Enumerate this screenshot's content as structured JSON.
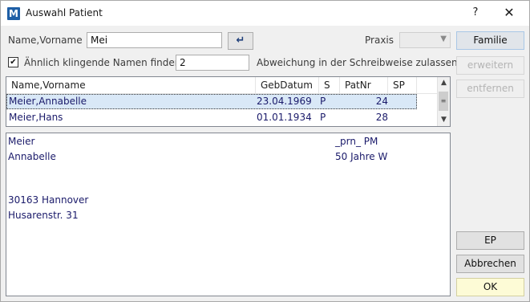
{
  "window": {
    "title": "Auswahl Patient",
    "app_icon_letter": "M",
    "help_label": "?",
    "close_label": "✕"
  },
  "search": {
    "name_label": "Name,Vorname",
    "name_value": "Mei",
    "enter_icon": "↵",
    "praxis_label": "Praxis",
    "praxis_value": "",
    "similar_label": "Ähnlich klingende Namen finden",
    "similar_checked": true,
    "deviation_value": "2",
    "deviation_label": "Abweichung in der Schreibweise zulassen"
  },
  "table": {
    "columns": [
      "Name,Vorname",
      "GebDatum",
      "S",
      "PatNr",
      "SP"
    ],
    "rows": [
      {
        "name": "Meier,Annabelle",
        "date": "23.04.1969",
        "s": "P",
        "patnr": "24",
        "sp": "",
        "selected": true
      },
      {
        "name": "Meier,Hans",
        "date": "01.01.1934",
        "s": "P",
        "patnr": "28",
        "sp": "",
        "selected": false
      }
    ]
  },
  "detail": {
    "surname": "Meier",
    "firstname": "Annabelle",
    "city": "30163 Hannover",
    "street": "Husarenstr. 31",
    "right1": "_prn_ PM",
    "right2": "50 Jahre W"
  },
  "buttons": {
    "familie": "Familie",
    "erweitern": "erweitern",
    "entfernen": "entfernen",
    "ep": "EP",
    "abbrechen": "Abbrechen",
    "ok": "OK"
  },
  "colors": {
    "accent": "#1f5fa6",
    "selected_row": "#d9e8f7",
    "ok_button": "#fdfbd6"
  }
}
